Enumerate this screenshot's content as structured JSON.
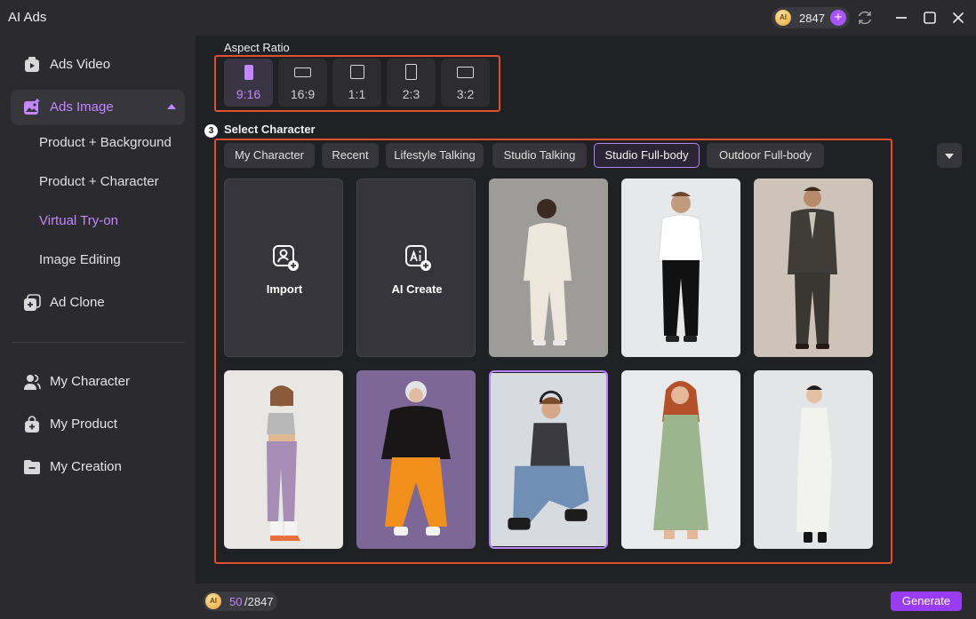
{
  "app": {
    "title": "AI Ads"
  },
  "header": {
    "credits": "2847"
  },
  "sidebar": {
    "items": [
      {
        "label": "Ads Video",
        "icon": "video-icon"
      },
      {
        "label": "Ads Image",
        "icon": "image-icon",
        "active": true
      },
      {
        "label": "Ad Clone",
        "icon": "clone-icon"
      }
    ],
    "subitems": [
      {
        "label": "Product + Background"
      },
      {
        "label": "Product + Character"
      },
      {
        "label": "Virtual Try-on",
        "active": true
      },
      {
        "label": "Image Editing"
      }
    ],
    "library": [
      {
        "label": "My Character",
        "icon": "user-group-icon"
      },
      {
        "label": "My Product",
        "icon": "bag-icon"
      },
      {
        "label": "My Creation",
        "icon": "folder-icon"
      }
    ]
  },
  "aspect_ratio": {
    "label": "Aspect Ratio",
    "options": [
      "9:16",
      "16:9",
      "1:1",
      "2:3",
      "3:2"
    ],
    "selected": "9:16"
  },
  "select_character": {
    "step": "3",
    "label": "Select Character",
    "tabs": [
      "My Character",
      "Recent",
      "Lifestyle Talking",
      "Studio Talking",
      "Studio Full-body",
      "Outdoor Full-body"
    ],
    "selected_tab": "Studio Full-body",
    "actions": [
      {
        "label": "Import",
        "icon": "import-user-icon"
      },
      {
        "label": "AI Create",
        "icon": "ai-create-icon"
      }
    ]
  },
  "footer": {
    "used": "50",
    "total": "/2847",
    "generate_label": "Generate"
  },
  "colors": {
    "accent": "#b982ff",
    "accent_text": "#c586ff",
    "highlight_border": "#e04f2f",
    "generate": "#9b3cf5",
    "background": "#202124",
    "panel": "#2b2b2f"
  }
}
